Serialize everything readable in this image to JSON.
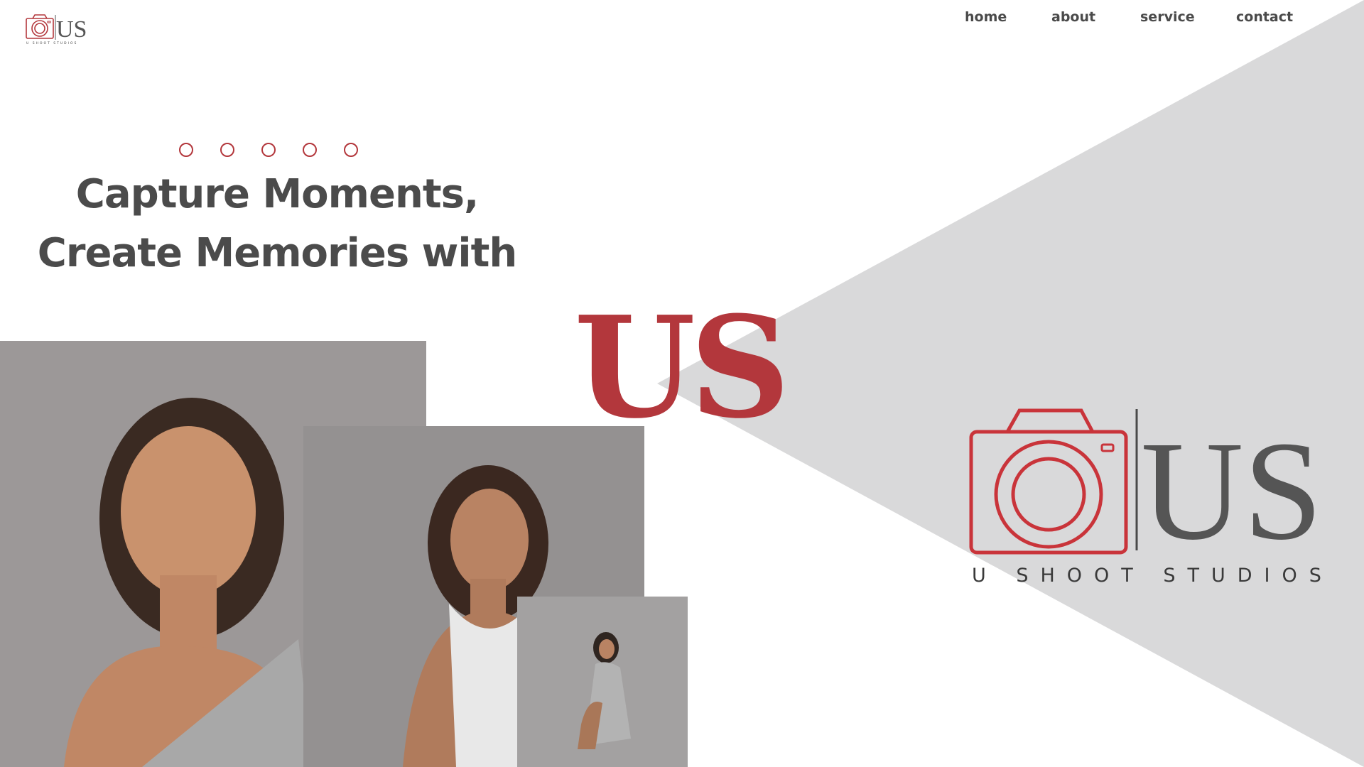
{
  "header": {
    "logo_text": "US",
    "logo_subtext": "U SHOOT STUDIOS",
    "nav": [
      {
        "label": "home"
      },
      {
        "label": "about"
      },
      {
        "label": "service"
      },
      {
        "label": "contact"
      }
    ]
  },
  "hero": {
    "slider_dot_count": 5,
    "headline_line1": "Capture Moments,",
    "headline_line2": "Create Memories with",
    "big_word": "US"
  },
  "brand": {
    "logo_text": "US",
    "tagline": "U SHOOT STUDIOS"
  },
  "colors": {
    "accent": "#b3373c",
    "text": "#4b4b4b",
    "triangle": "#d9d9da",
    "photo_bg": "#9a9797"
  }
}
